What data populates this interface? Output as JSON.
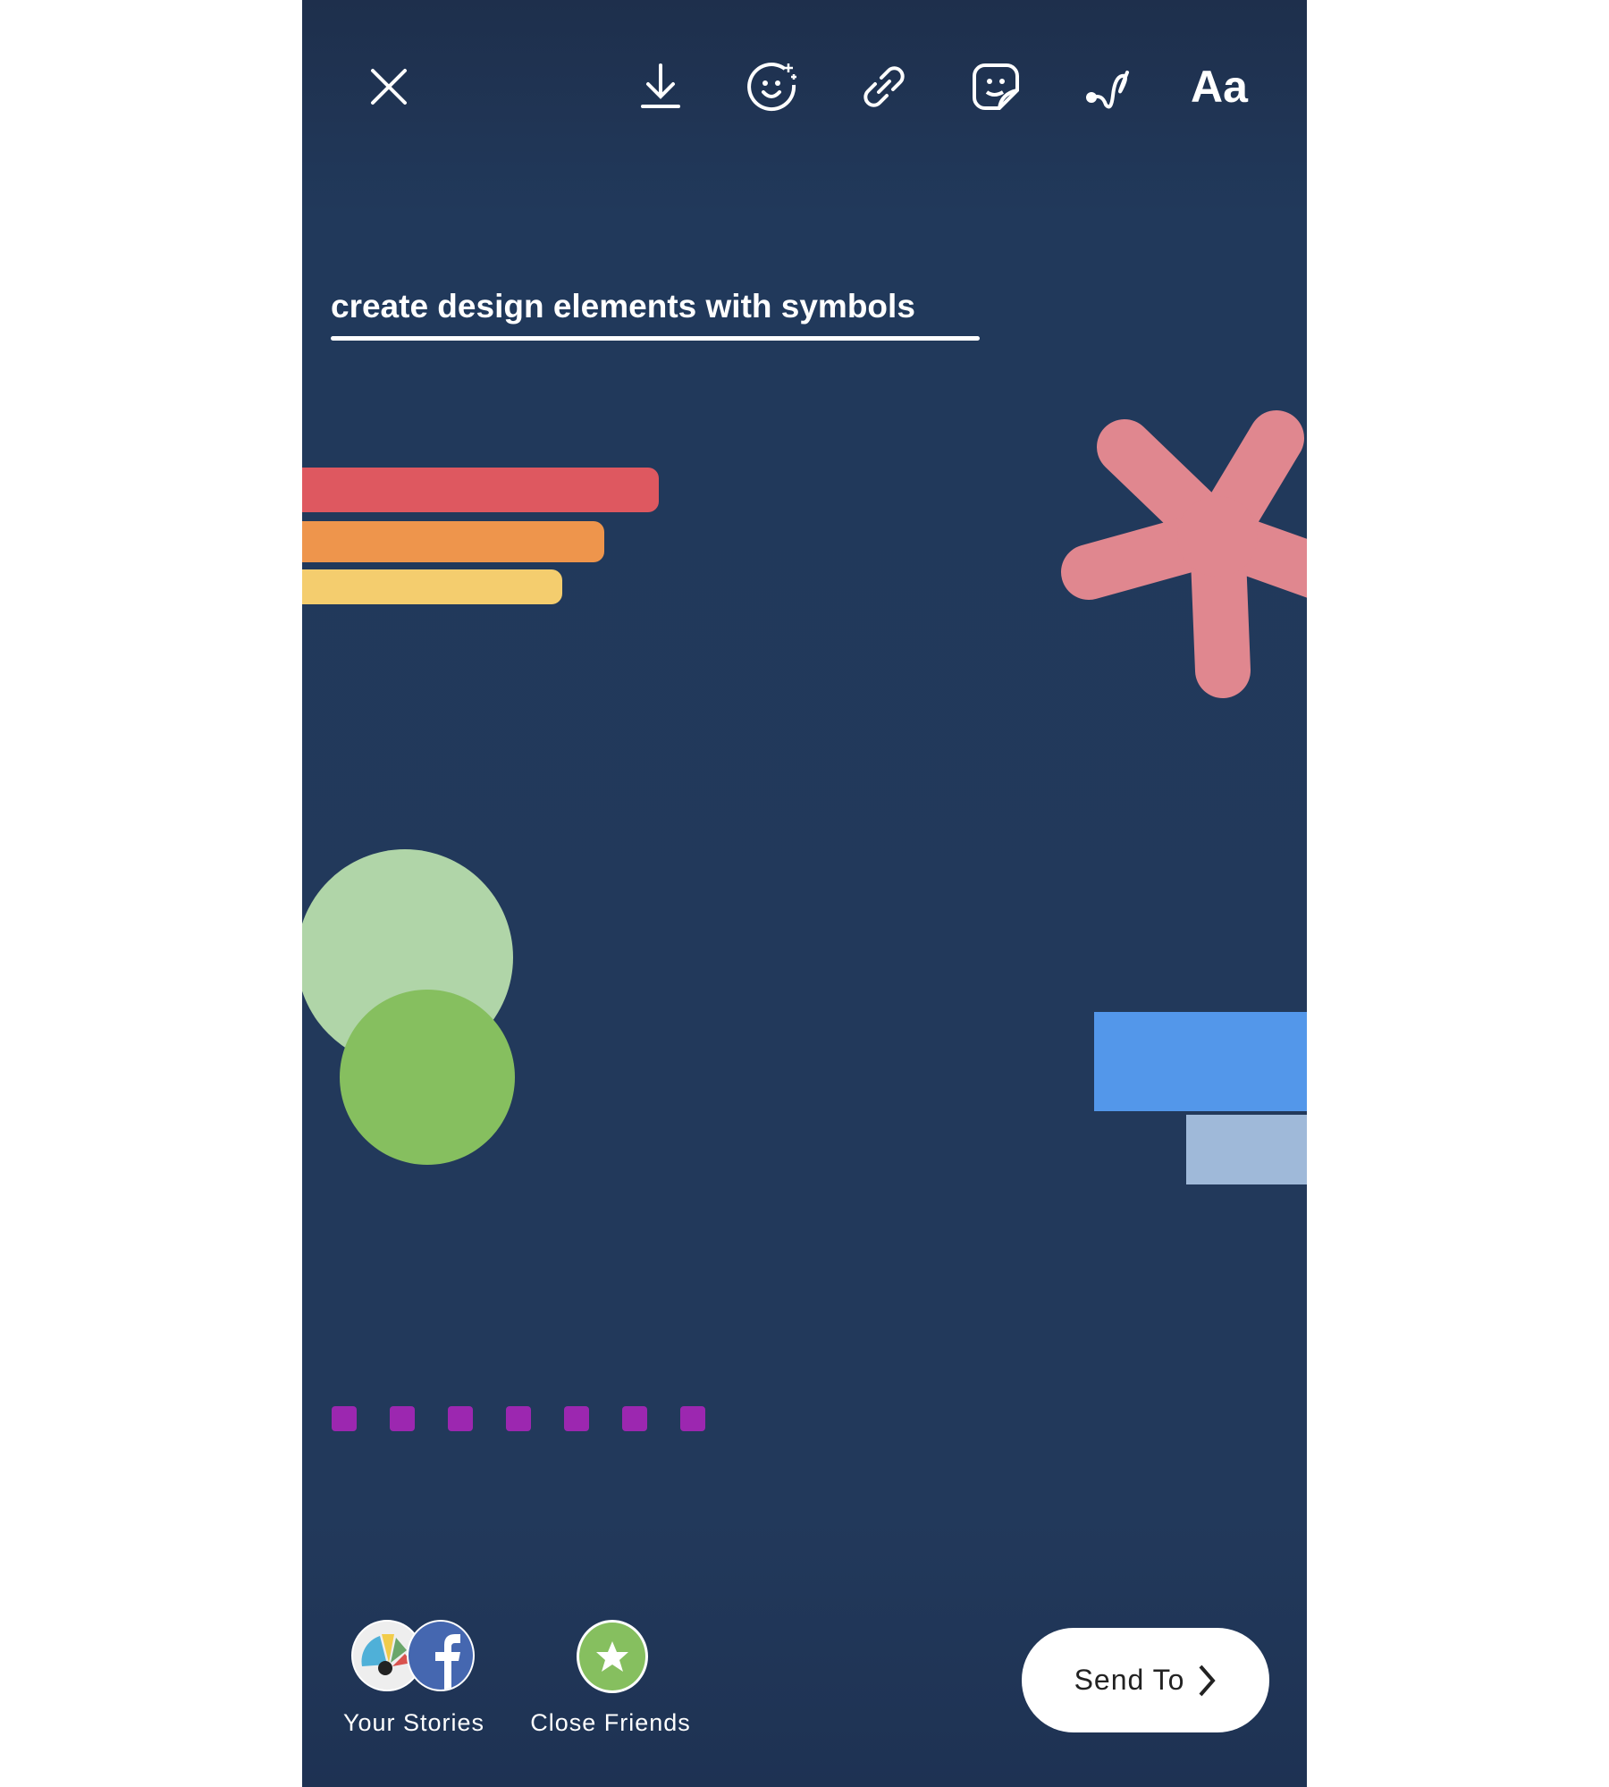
{
  "toolbar": {
    "icons": [
      "close-icon",
      "download-icon",
      "face-effects-icon",
      "link-icon",
      "sticker-icon",
      "draw-icon",
      "text-icon"
    ],
    "text_tool_label": "Aa"
  },
  "canvas": {
    "caption": "create design elements with symbols",
    "colors": {
      "background": "#21395b",
      "red_bar": "#de5860",
      "orange_bar": "#ee954c",
      "yellow_bar": "#f4cd6e",
      "asterisk": "#e0878f",
      "light_green_circle": "#b0d5a8",
      "green_circle": "#86bf5f",
      "blue_rect": "#5397ea",
      "light_blue_rect": "#9fb9d9",
      "purple_squares": "#9c27b0"
    }
  },
  "bottom": {
    "your_stories_label": "Your Stories",
    "close_friends_label": "Close Friends",
    "send_to_label": "Send To"
  }
}
